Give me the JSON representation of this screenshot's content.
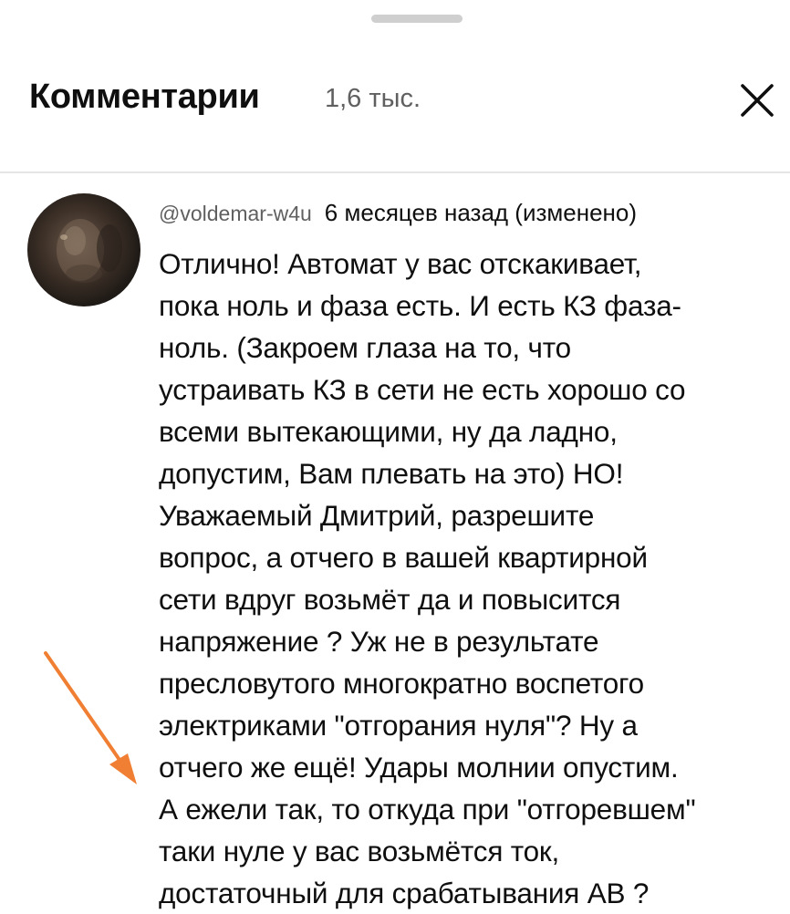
{
  "header": {
    "title": "Комментарии",
    "count": "1,6 тыс."
  },
  "comment": {
    "author": "@voldemar-w4u",
    "time": "6 месяцев назад (изменено)",
    "lines": [
      "Отлично! Автомат у вас отскакивает,",
      "пока ноль и фаза есть. И есть КЗ фаза-",
      "ноль. (Закроем глаза на то, что",
      "устраивать КЗ в сети не есть хорошо со",
      "всеми вытекающими, ну да ладно,",
      "допустим, Вам плевать на это) НО!",
      "Уважаемый Дмитрий, разрешите",
      "вопрос, а отчего в вашей квартирной",
      "сети вдруг возьмёт да и повысится",
      "напряжение ? Уж не в результате",
      "пресловутого многократно воспетого",
      "электриками \"отгорания нуля\"? Ну а",
      "отчего же ещё! Удары молнии опустим.",
      "А ежели так, то откуда при \"отгоревшем\"",
      "таки нуле у вас возьмётся ток,",
      "достаточный для срабатывания АВ ?"
    ]
  },
  "icons": {
    "close": "close-icon",
    "annotation": "arrow-annotation-icon"
  },
  "colors": {
    "annotation_arrow": "#f07f33",
    "secondary_text": "#606060",
    "divider": "#e5e5e5"
  }
}
